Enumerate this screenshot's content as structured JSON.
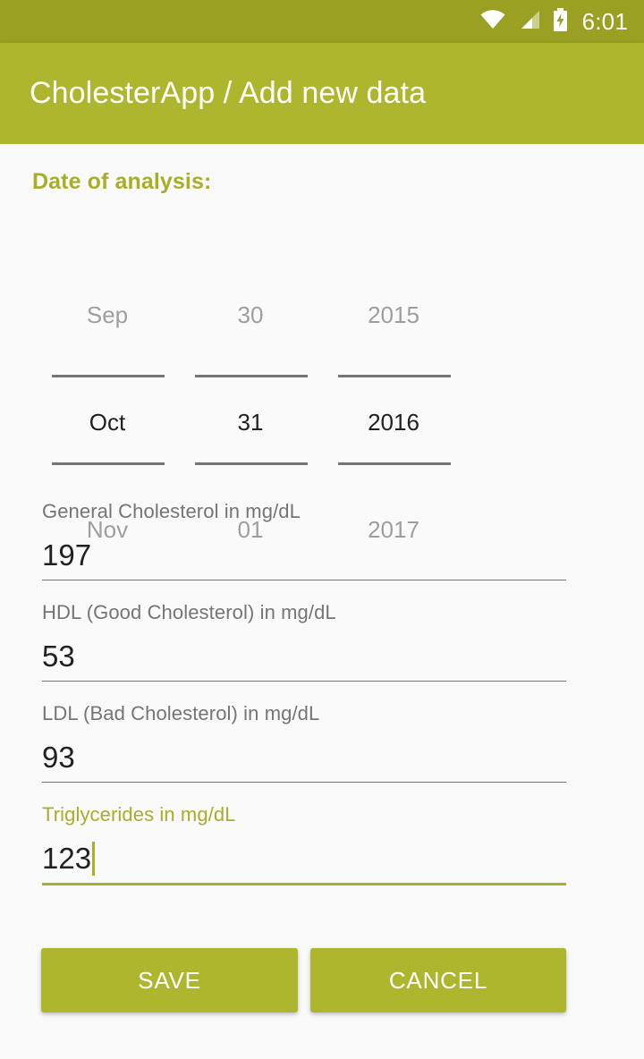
{
  "status_bar": {
    "time": "6:01",
    "icons": [
      "wifi-icon",
      "cellular-signal-icon",
      "battery-charging-icon"
    ],
    "background": "#9aa022"
  },
  "app_bar": {
    "title": "CholesterApp / Add new data",
    "background": "#aeb62e",
    "text_color": "#ffffff"
  },
  "theme": {
    "accent": "#a8ae26",
    "accent_underline": "#a9b02c",
    "page_background": "#fafafa",
    "label_gray": "#757575",
    "dim_gray": "#9e9e9e",
    "value_black": "#212121"
  },
  "date_section": {
    "label": "Date of analysis:",
    "picker": {
      "columns": [
        {
          "name": "month-column",
          "previous": "Sep",
          "selected": "Oct",
          "next": "Nov"
        },
        {
          "name": "day-column",
          "previous": "30",
          "selected": "31",
          "next": "01"
        },
        {
          "name": "year-column",
          "previous": "2015",
          "selected": "2016",
          "next": "2017"
        }
      ]
    }
  },
  "fields": [
    {
      "key": "general",
      "label": "General Cholesterol in mg/dL",
      "value": "197",
      "focused": false
    },
    {
      "key": "hdl",
      "label": "HDL (Good Cholesterol) in mg/dL",
      "value": "53",
      "focused": false
    },
    {
      "key": "ldl",
      "label": "LDL (Bad Cholesterol) in mg/dL",
      "value": "93",
      "focused": false
    },
    {
      "key": "tri",
      "label": "Triglycerides in mg/dL",
      "value": "123",
      "focused": true
    }
  ],
  "buttons": {
    "save": "SAVE",
    "cancel": "CANCEL"
  }
}
